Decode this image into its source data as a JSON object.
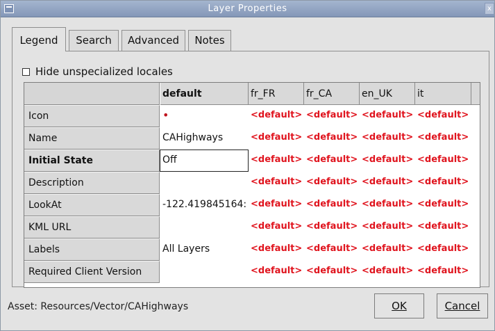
{
  "window": {
    "title": "Layer Properties",
    "close_label": "x"
  },
  "tabs": [
    {
      "label": "Legend",
      "active": true
    },
    {
      "label": "Search",
      "active": false
    },
    {
      "label": "Advanced",
      "active": false
    },
    {
      "label": "Notes",
      "active": false
    }
  ],
  "legend": {
    "hide_unspecialized_label": "Hide unspecialized locales",
    "hide_unspecialized_checked": false,
    "columns": [
      "default",
      "fr_FR",
      "fr_CA",
      "en_UK",
      "it"
    ],
    "rows": [
      {
        "label": "Icon",
        "default": "•"
      },
      {
        "label": "Name",
        "default": "CAHighways"
      },
      {
        "label": "Initial State",
        "default": "Off"
      },
      {
        "label": "Description",
        "default": ""
      },
      {
        "label": "LookAt",
        "default": "-122.419845164:"
      },
      {
        "label": "KML URL",
        "default": ""
      },
      {
        "label": "Labels",
        "default": "All Layers"
      },
      {
        "label": "Required Client Version",
        "default": ""
      }
    ],
    "locale_placeholder": "<default>"
  },
  "footer": {
    "asset_text": "Asset: Resources/Vector/CAHighways",
    "ok_label": "OK",
    "cancel_label": "Cancel"
  },
  "colors": {
    "placeholder": "#e0141e",
    "titlebar": "#8fa1c0"
  }
}
